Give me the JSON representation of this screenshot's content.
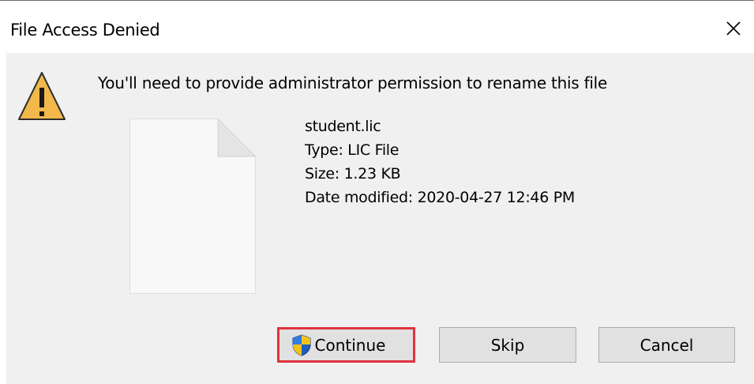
{
  "dialog": {
    "title": "File Access Denied",
    "message": "You'll need to provide administrator permission to rename this file",
    "icons": {
      "warning": "warning-icon",
      "file": "file-icon",
      "close": "close-icon",
      "shield": "uac-shield-icon"
    }
  },
  "file": {
    "name": "student.lic",
    "type": "Type: LIC File",
    "size": "Size: 1.23 KB",
    "modified": "Date modified: 2020-04-27 12:46 PM"
  },
  "buttons": {
    "continue": "Continue",
    "skip": "Skip",
    "cancel": "Cancel"
  },
  "colors": {
    "highlight": "#e0333f",
    "warning_fill": "#f2b84b",
    "content_bg": "#f0f0f0"
  }
}
